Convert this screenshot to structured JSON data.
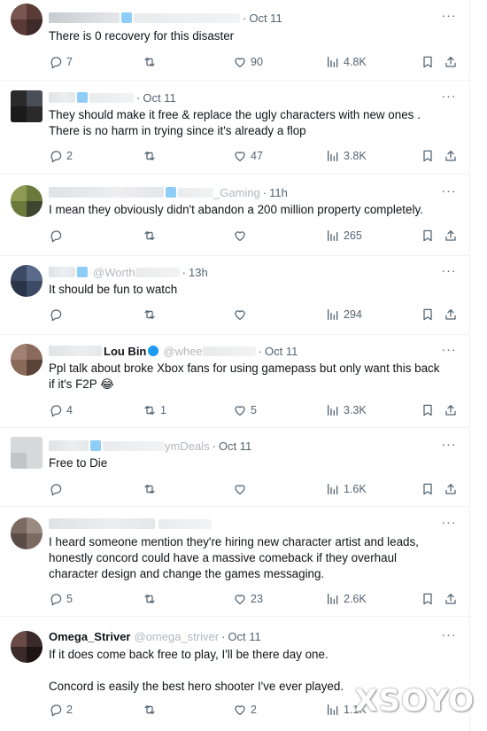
{
  "tweets": [
    {
      "time": "Oct 11",
      "text": "There is 0 recovery for this disaster",
      "replies": "7",
      "reposts": "",
      "likes": "90",
      "views": "4.8K"
    },
    {
      "time": "Oct 11",
      "text": "They should make it free & replace the ugly characters with new ones .\nThere is no harm in trying since it's already a flop",
      "replies": "2",
      "reposts": "",
      "likes": "47",
      "views": "3.8K"
    },
    {
      "time": "11h",
      "text": "I mean they obviously didn't abandon a 200 million property completely.",
      "replies": "",
      "reposts": "",
      "likes": "",
      "views": "265"
    },
    {
      "time": "13h",
      "text": "It should be fun to watch",
      "replies": "",
      "reposts": "",
      "likes": "",
      "views": "294"
    },
    {
      "time": "Oct 11",
      "text": "Ppl talk about broke Xbox fans for using gamepass but only want this back\nif it's F2P 😂",
      "replies": "4",
      "reposts": "1",
      "likes": "5",
      "views": "3.3K"
    },
    {
      "time": "Oct 11",
      "text": "Free to Die",
      "replies": "",
      "reposts": "",
      "likes": "",
      "views": "1.6K"
    },
    {
      "time": "",
      "text": "I heard someone mention they're hiring new character artist and leads,\nhonestly concord could have a massive comeback if they overhaul\ncharacter design and change the games messaging.",
      "replies": "5",
      "reposts": "",
      "likes": "23",
      "views": "2.6K"
    },
    {
      "time": "Oct 11",
      "text": "If it does come back free to play, I'll be there day one.\n\nConcord is easily the best hero shooter I've ever played.",
      "replies": "2",
      "reposts": "",
      "likes": "2",
      "views": "1.1K"
    }
  ],
  "header_fragments": {
    "t3_handle": "_Gaming",
    "t4_handle": "@Worth",
    "t5_name": "Lou Bin",
    "t5_handle": "@whee",
    "t6_handle": "ymDeals",
    "t8_name": "Omega_Striver",
    "t8_handle": "@omega_striver"
  },
  "watermark": "XSOYO",
  "icons": [
    "reply-icon",
    "repost-icon",
    "like-icon",
    "views-icon",
    "bookmark-icon",
    "share-icon",
    "more-icon"
  ],
  "colors": {
    "text": "#0f1419",
    "secondary": "#536471",
    "divider": "#eff3f4",
    "verified": "#1d9bf0"
  }
}
